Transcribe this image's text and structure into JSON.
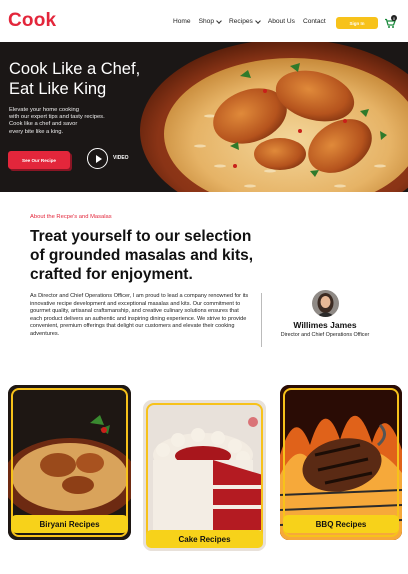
{
  "header": {
    "logo": "Cook",
    "nav": [
      {
        "label": "Home",
        "has_dropdown": false
      },
      {
        "label": "Shop",
        "has_dropdown": true
      },
      {
        "label": "Recipes",
        "has_dropdown": true
      },
      {
        "label": "About Us",
        "has_dropdown": false
      },
      {
        "label": "Contact",
        "has_dropdown": false
      }
    ],
    "signin_label": "Sign In",
    "cart_icon": "cart-icon",
    "cart_count": "0"
  },
  "hero": {
    "title_line1": "Cook Like a Chef,",
    "title_line2": "Eat Like King",
    "subtitle_line1": "Elevate your home cooking",
    "subtitle_line2": "with our expert tips and tasty recipes.",
    "subtitle_line3": "Cook like a chef and savor",
    "subtitle_line4": "every bite like a king.",
    "cta_label": "See Our Recipe",
    "video_label": "VIDEO",
    "play_icon": "play-icon"
  },
  "about": {
    "kicker": "About the Recpe's and Masalas",
    "heading_line1": "Treat yourself to our selection",
    "heading_line2": "of grounded masalas and kits,",
    "heading_line3": "crafted for enjoyment.",
    "body": "As Director and Chief Operations Officer, I am proud to lead a company renowned for its innovative recipe development and exceptional masalas and kits. Our commitment to gourmet quality, artisanal craftsmanship, and creative culinary solutions ensures that each product delivers an authentic and inspiring dining experience. We strive to provide convenient, premium offerings that delight our customers and elevate their cooking adventures.",
    "person_name": "Willimes James",
    "person_role": "Director and Chief Operations Officer"
  },
  "cards": [
    {
      "label": "Biryani Recipes"
    },
    {
      "label": "Cake Recipes"
    },
    {
      "label": "BBQ Recipes"
    }
  ],
  "colors": {
    "brand_red": "#e3263b",
    "accent_yellow": "#f7c21a",
    "hero_bg": "#1b1716"
  }
}
